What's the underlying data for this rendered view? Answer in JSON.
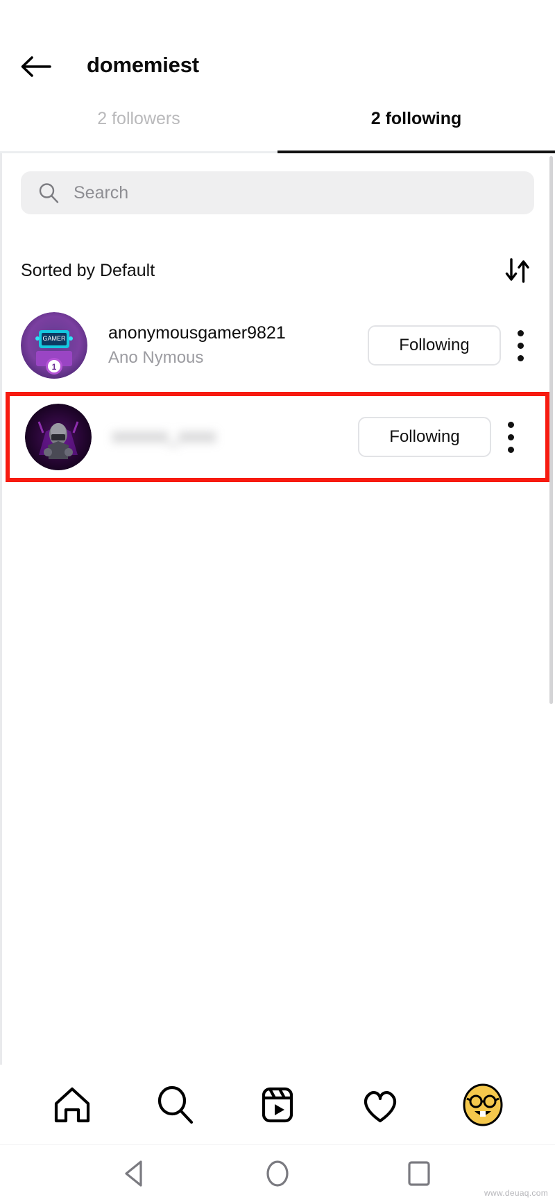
{
  "header": {
    "back_icon": "back-arrow-icon",
    "title": "domemiest"
  },
  "tabs": [
    {
      "label": "2 followers",
      "active": false
    },
    {
      "label": "2 following",
      "active": true
    }
  ],
  "search": {
    "icon": "search-icon",
    "placeholder": "Search",
    "value": ""
  },
  "sort": {
    "label": "Sorted by Default",
    "icon": "sort-arrows-icon"
  },
  "users": [
    {
      "username": "anonymousgamer9821",
      "fullname": "Ano Nymous",
      "button_label": "Following",
      "avatar": "gamer-setup-avatar",
      "blurred": false,
      "highlighted": false
    },
    {
      "username": "xxxxxx_xxxx",
      "fullname": "",
      "button_label": "Following",
      "avatar": "hooded-gamer-avatar",
      "blurred": true,
      "highlighted": true
    }
  ],
  "highlight": {
    "color": "#f71b10"
  },
  "bottom_nav": [
    {
      "icon": "home-icon",
      "label": "Home"
    },
    {
      "icon": "search-icon",
      "label": "Search"
    },
    {
      "icon": "reels-icon",
      "label": "Reels"
    },
    {
      "icon": "heart-icon",
      "label": "Activity"
    },
    {
      "icon": "profile-avatar-nerd-face",
      "label": "Profile"
    }
  ],
  "system_bar": [
    {
      "icon": "android-back-icon",
      "label": "Back"
    },
    {
      "icon": "android-home-icon",
      "label": "Home"
    },
    {
      "icon": "android-recents-icon",
      "label": "Recents"
    }
  ],
  "watermark": "www.deuaq.com",
  "colors": {
    "accent_highlight": "#f71b10",
    "text_primary": "#0d0d0d",
    "text_secondary": "#9c9ca1",
    "search_bg": "#efeff0",
    "tab_underline": "#121212"
  }
}
